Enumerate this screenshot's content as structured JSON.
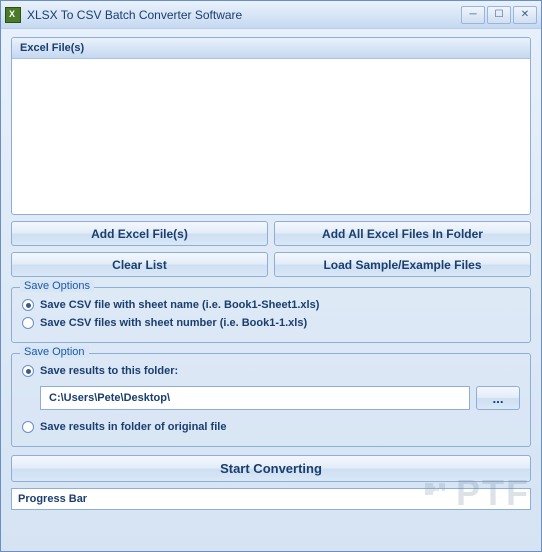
{
  "window": {
    "title": "XLSX To CSV Batch Converter Software"
  },
  "filePanel": {
    "header": "Excel File(s)"
  },
  "buttons": {
    "addFiles": "Add Excel File(s)",
    "addFolder": "Add All Excel Files In Folder",
    "clearList": "Clear List",
    "loadSample": "Load Sample/Example Files",
    "browse": "...",
    "start": "Start Converting"
  },
  "saveOptions": {
    "legend": "Save Options",
    "opt1": "Save CSV file with sheet name (i.e. Book1-Sheet1.xls)",
    "opt2": "Save CSV files with sheet number (i.e. Book1-1.xls)"
  },
  "saveOption": {
    "legend": "Save Option",
    "opt1": "Save results to this folder:",
    "folderPath": "C:\\Users\\Pete\\Desktop\\",
    "opt2": "Save results in folder of original file"
  },
  "progress": {
    "label": "Progress Bar"
  },
  "watermark": "PTF"
}
